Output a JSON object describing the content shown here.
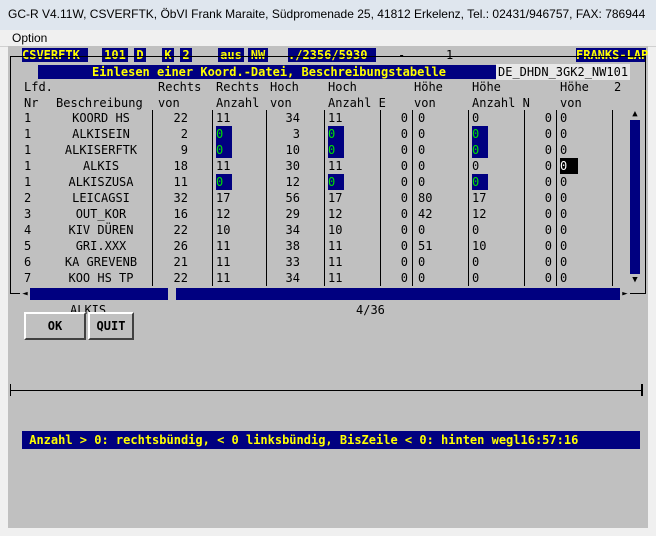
{
  "window": {
    "title": "GC-R V4.11W, CSVERFTK, ÖbVI Frank Maraite, Südpromenade 25, 41812 Erkelenz, Tel.: 02431/946757, FAX: 786944"
  },
  "menu": {
    "option": "Option"
  },
  "header": {
    "program": "CSVERFTK",
    "f1": "101",
    "f2": "D",
    "f3": "K",
    "f4": "2",
    "f5": "aus",
    "f6": "NW",
    "f7": "./2356/5930",
    "f8": "-",
    "f9": "1",
    "user": "FRANKS-LAP",
    "subtitle": "Einlesen einer Koord.-Datei, Beschreibungstabelle",
    "table_id": "DE_DHDN_3GK2_NW101"
  },
  "columns": {
    "r1": {
      "lfd": "Lfd.",
      "rechts1": "Rechts",
      "rechts2": "Rechts",
      "hoch1": "Hoch",
      "hoch2": "Hoch",
      "hoehe1": "Höhe",
      "hoehe2": "Höhe",
      "hoehe3": "Höhe",
      "two": "2"
    },
    "r2": {
      "nr": "Nr",
      "beschreibung": "Beschreibung",
      "von1": "von",
      "anzahl1": "Anzahl",
      "von2": "von",
      "anzahl2": "Anzahl E",
      "von3": "von",
      "anzahl3": "Anzahl N",
      "von4": "von"
    }
  },
  "rows": [
    {
      "nr": "1",
      "desc": "KOORD HS",
      "rv": "22",
      "ra": "11",
      "hv": "34",
      "ha": "11",
      "e": "0",
      "hov": "0",
      "hoa": "0",
      "n": "0",
      "h2": "0"
    },
    {
      "nr": "1",
      "desc": "ALKISEIN",
      "rv": "2",
      "ra": "0",
      "hv": "3",
      "ha": "0",
      "e": "0",
      "hov": "0",
      "hoa": "0",
      "n": "0",
      "h2": "0"
    },
    {
      "nr": "1",
      "desc": "ALKISERFTK",
      "rv": "9",
      "ra": "0",
      "hv": "10",
      "ha": "0",
      "e": "0",
      "hov": "0",
      "hoa": "0",
      "n": "0",
      "h2": "0"
    },
    {
      "nr": "1",
      "desc": "ALKIS",
      "rv": "18",
      "ra": "11",
      "hv": "30",
      "ha": "11",
      "e": "0",
      "hov": "0",
      "hoa": "0",
      "n": "0",
      "h2": "0"
    },
    {
      "nr": "1",
      "desc": "ALKISZUSA",
      "rv": "11",
      "ra": "0",
      "hv": "12",
      "ha": "0",
      "e": "0",
      "hov": "0",
      "hoa": "0",
      "n": "0",
      "h2": "0"
    },
    {
      "nr": "2",
      "desc": "LEICAGSI",
      "rv": "32",
      "ra": "17",
      "hv": "56",
      "ha": "17",
      "e": "0",
      "hov": "80",
      "hoa": "17",
      "n": "0",
      "h2": "0"
    },
    {
      "nr": "3",
      "desc": "OUT_KOR",
      "rv": "16",
      "ra": "12",
      "hv": "29",
      "ha": "12",
      "e": "0",
      "hov": "42",
      "hoa": "12",
      "n": "0",
      "h2": "0"
    },
    {
      "nr": "4",
      "desc": "KIV DÜREN",
      "rv": "22",
      "ra": "10",
      "hv": "34",
      "ha": "10",
      "e": "0",
      "hov": "0",
      "hoa": "0",
      "n": "0",
      "h2": "0"
    },
    {
      "nr": "5",
      "desc": "GRI.XXX",
      "rv": "26",
      "ra": "11",
      "hv": "38",
      "ha": "11",
      "e": "0",
      "hov": "51",
      "hoa": "10",
      "n": "0",
      "h2": "0"
    },
    {
      "nr": "6",
      "desc": "KA GREVENB",
      "rv": "21",
      "ra": "11",
      "hv": "33",
      "ha": "11",
      "e": "0",
      "hov": "0",
      "hoa": "0",
      "n": "0",
      "h2": "0"
    },
    {
      "nr": "7",
      "desc": "KOO HS TP",
      "rv": "22",
      "ra": "11",
      "hv": "34",
      "ha": "11",
      "e": "0",
      "hov": "0",
      "hoa": "0",
      "n": "0",
      "h2": "0"
    }
  ],
  "footer": {
    "selected_name": "ALKIS",
    "position": "4/36",
    "ok_label": "OK",
    "quit_label": "QUIT",
    "status": " Anzahl > 0: rechtsbündig, < 0 linksbündig, BisZeile < 0: hinten wegl16:57:16"
  },
  "scroll": {
    "up": "▲",
    "down": "▼",
    "left": "◄",
    "right": "►"
  }
}
